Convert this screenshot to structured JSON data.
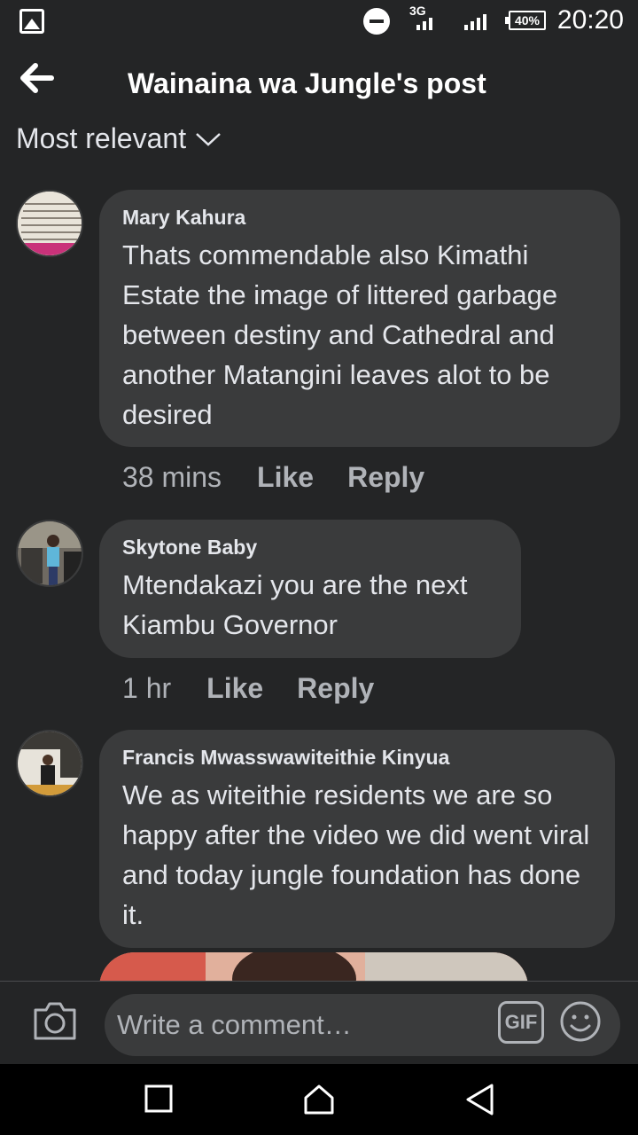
{
  "status_bar": {
    "network": "3G",
    "battery": "40%",
    "time": "20:20"
  },
  "header": {
    "title": "Wainaina wa Jungle's post"
  },
  "sort": {
    "label": "Most relevant"
  },
  "comments": [
    {
      "author": "Mary Kahura",
      "text": "Thats commendable also Kimathi Estate the image of littered garbage between destiny and Cathedral and another Matangini leaves alot to be desired",
      "time": "38 mins",
      "like": "Like",
      "reply": "Reply"
    },
    {
      "author": "Skytone  Baby",
      "text": "Mtendakazi you are the next Kiambu Governor",
      "time": "1 hr",
      "like": "Like",
      "reply": "Reply"
    },
    {
      "author": "Francis Mwasswawiteithie Kinyua",
      "text": "We as witeithie residents we are so happy after the video we did went viral and today jungle foundation has done it.",
      "time": "",
      "like": "",
      "reply": ""
    }
  ],
  "composer": {
    "placeholder": "Write a comment…",
    "gif_label": "GIF"
  },
  "icons": [
    "gallery-icon",
    "dnd-icon",
    "signal-icon",
    "battery-icon",
    "back-arrow-icon",
    "chevron-down-icon",
    "camera-icon",
    "emoji-icon",
    "recents-icon",
    "home-icon",
    "back-icon"
  ]
}
